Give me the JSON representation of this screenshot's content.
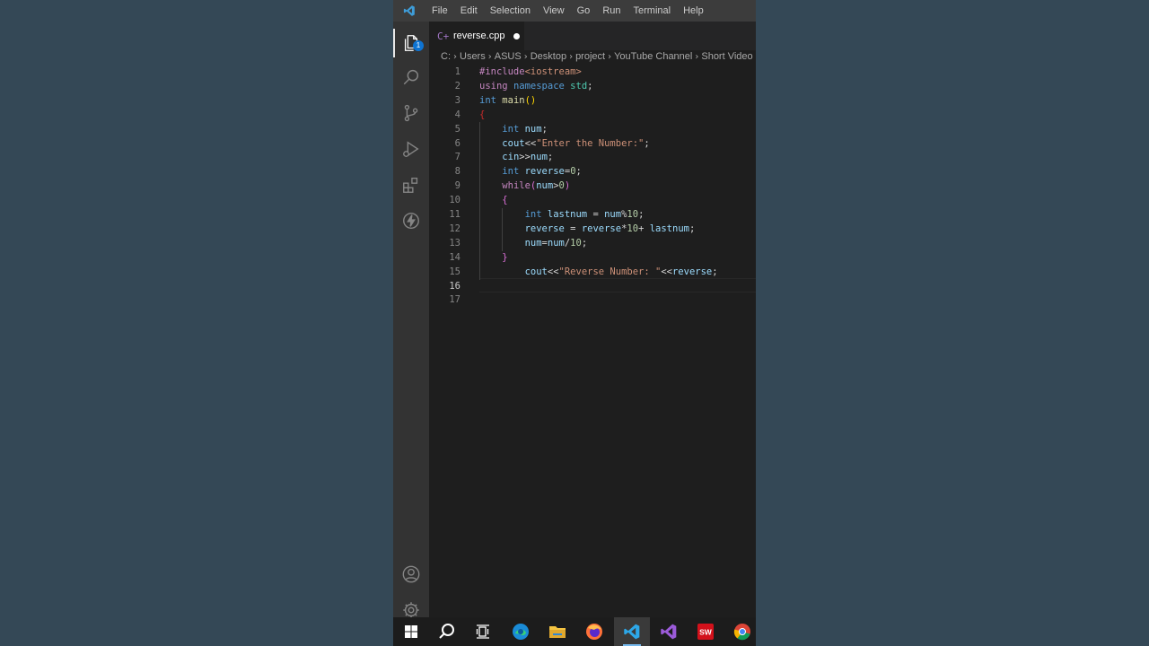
{
  "menubar": {
    "items": [
      "File",
      "Edit",
      "Selection",
      "View",
      "Go",
      "Run",
      "Terminal",
      "Help"
    ]
  },
  "activity_bar": {
    "explorer_badge": "1",
    "icons": [
      "files-icon",
      "search-icon",
      "source-control-icon",
      "run-debug-icon",
      "extensions-icon",
      "lightning-icon",
      "account-icon",
      "gear-icon"
    ]
  },
  "tab": {
    "icon": "C+",
    "label": "reverse.cpp"
  },
  "breadcrumb": [
    "C:",
    "Users",
    "ASUS",
    "Desktop",
    "project",
    "YouTube Channel",
    "Short Video"
  ],
  "editor": {
    "active_line": 16,
    "lines": [
      {
        "n": "1",
        "tokens": [
          {
            "t": "#include",
            "c": "#c586c0"
          },
          {
            "t": "<iostream>",
            "c": "#ce9178"
          }
        ]
      },
      {
        "n": "2",
        "tokens": [
          {
            "t": "using",
            "c": "#c586c0"
          },
          {
            "t": " ",
            "c": "#d4d4d4"
          },
          {
            "t": "namespace",
            "c": "#569cd6"
          },
          {
            "t": " ",
            "c": "#d4d4d4"
          },
          {
            "t": "std",
            "c": "#4ec9b0"
          },
          {
            "t": ";",
            "c": "#d4d4d4"
          }
        ]
      },
      {
        "n": "3",
        "tokens": [
          {
            "t": "int",
            "c": "#569cd6"
          },
          {
            "t": " ",
            "c": "#d4d4d4"
          },
          {
            "t": "main",
            "c": "#dcdcaa"
          },
          {
            "t": "()",
            "c": "#ffd700"
          }
        ]
      },
      {
        "n": "4",
        "tokens": [
          {
            "t": "{",
            "c": "#c82a2a"
          }
        ]
      },
      {
        "n": "5",
        "tokens": [
          {
            "t": "    ",
            "c": "#d4d4d4"
          },
          {
            "t": "int",
            "c": "#569cd6"
          },
          {
            "t": " ",
            "c": "#d4d4d4"
          },
          {
            "t": "num",
            "c": "#9cdcfe"
          },
          {
            "t": ";",
            "c": "#d4d4d4"
          }
        ]
      },
      {
        "n": "6",
        "tokens": [
          {
            "t": "    ",
            "c": "#d4d4d4"
          },
          {
            "t": "cout",
            "c": "#9cdcfe"
          },
          {
            "t": "<<",
            "c": "#d4d4d4"
          },
          {
            "t": "\"Enter the Number:\"",
            "c": "#ce9178"
          },
          {
            "t": ";",
            "c": "#d4d4d4"
          }
        ]
      },
      {
        "n": "7",
        "tokens": [
          {
            "t": "    ",
            "c": "#d4d4d4"
          },
          {
            "t": "cin",
            "c": "#9cdcfe"
          },
          {
            "t": ">>",
            "c": "#d4d4d4"
          },
          {
            "t": "num",
            "c": "#9cdcfe"
          },
          {
            "t": ";",
            "c": "#d4d4d4"
          }
        ]
      },
      {
        "n": "8",
        "tokens": [
          {
            "t": "    ",
            "c": "#d4d4d4"
          },
          {
            "t": "int",
            "c": "#569cd6"
          },
          {
            "t": " ",
            "c": "#d4d4d4"
          },
          {
            "t": "reverse",
            "c": "#9cdcfe"
          },
          {
            "t": "=",
            "c": "#d4d4d4"
          },
          {
            "t": "0",
            "c": "#b5cea8"
          },
          {
            "t": ";",
            "c": "#d4d4d4"
          }
        ]
      },
      {
        "n": "9",
        "tokens": [
          {
            "t": "    ",
            "c": "#d4d4d4"
          },
          {
            "t": "while",
            "c": "#c586c0"
          },
          {
            "t": "(",
            "c": "#da70d6"
          },
          {
            "t": "num",
            "c": "#9cdcfe"
          },
          {
            "t": ">",
            "c": "#d4d4d4"
          },
          {
            "t": "0",
            "c": "#b5cea8"
          },
          {
            "t": ")",
            "c": "#da70d6"
          }
        ]
      },
      {
        "n": "10",
        "tokens": [
          {
            "t": "    ",
            "c": "#d4d4d4"
          },
          {
            "t": "{",
            "c": "#da70d6"
          }
        ]
      },
      {
        "n": "11",
        "tokens": [
          {
            "t": "        ",
            "c": "#d4d4d4"
          },
          {
            "t": "int",
            "c": "#569cd6"
          },
          {
            "t": " ",
            "c": "#d4d4d4"
          },
          {
            "t": "lastnum",
            "c": "#9cdcfe"
          },
          {
            "t": " = ",
            "c": "#d4d4d4"
          },
          {
            "t": "num",
            "c": "#9cdcfe"
          },
          {
            "t": "%",
            "c": "#d4d4d4"
          },
          {
            "t": "10",
            "c": "#b5cea8"
          },
          {
            "t": ";",
            "c": "#d4d4d4"
          }
        ]
      },
      {
        "n": "12",
        "tokens": [
          {
            "t": "        ",
            "c": "#d4d4d4"
          },
          {
            "t": "reverse",
            "c": "#9cdcfe"
          },
          {
            "t": " = ",
            "c": "#d4d4d4"
          },
          {
            "t": "reverse",
            "c": "#9cdcfe"
          },
          {
            "t": "*",
            "c": "#d4d4d4"
          },
          {
            "t": "10",
            "c": "#b5cea8"
          },
          {
            "t": "+ ",
            "c": "#d4d4d4"
          },
          {
            "t": "lastnum",
            "c": "#9cdcfe"
          },
          {
            "t": ";",
            "c": "#d4d4d4"
          }
        ]
      },
      {
        "n": "13",
        "tokens": [
          {
            "t": "        ",
            "c": "#d4d4d4"
          },
          {
            "t": "num",
            "c": "#9cdcfe"
          },
          {
            "t": "=",
            "c": "#d4d4d4"
          },
          {
            "t": "num",
            "c": "#9cdcfe"
          },
          {
            "t": "/",
            "c": "#d4d4d4"
          },
          {
            "t": "10",
            "c": "#b5cea8"
          },
          {
            "t": ";",
            "c": "#d4d4d4"
          }
        ]
      },
      {
        "n": "14",
        "tokens": [
          {
            "t": "    ",
            "c": "#d4d4d4"
          },
          {
            "t": "}",
            "c": "#da70d6"
          }
        ]
      },
      {
        "n": "15",
        "tokens": [
          {
            "t": "        ",
            "c": "#d4d4d4"
          },
          {
            "t": "cout",
            "c": "#9cdcfe"
          },
          {
            "t": "<<",
            "c": "#d4d4d4"
          },
          {
            "t": "\"Reverse Number: \"",
            "c": "#ce9178"
          },
          {
            "t": "<<",
            "c": "#d4d4d4"
          },
          {
            "t": "reverse",
            "c": "#9cdcfe"
          },
          {
            "t": ";",
            "c": "#d4d4d4"
          }
        ]
      },
      {
        "n": "16",
        "tokens": []
      },
      {
        "n": "17",
        "tokens": []
      }
    ]
  },
  "taskbar": {
    "icons": [
      "windows-start-icon",
      "search-icon",
      "task-view-icon",
      "edge-icon",
      "file-explorer-icon",
      "firefox-icon",
      "vscode-icon",
      "visual-studio-icon",
      "solidworks-icon",
      "chrome-icon"
    ],
    "active": "vscode-icon",
    "solidworks_label": "SW"
  }
}
